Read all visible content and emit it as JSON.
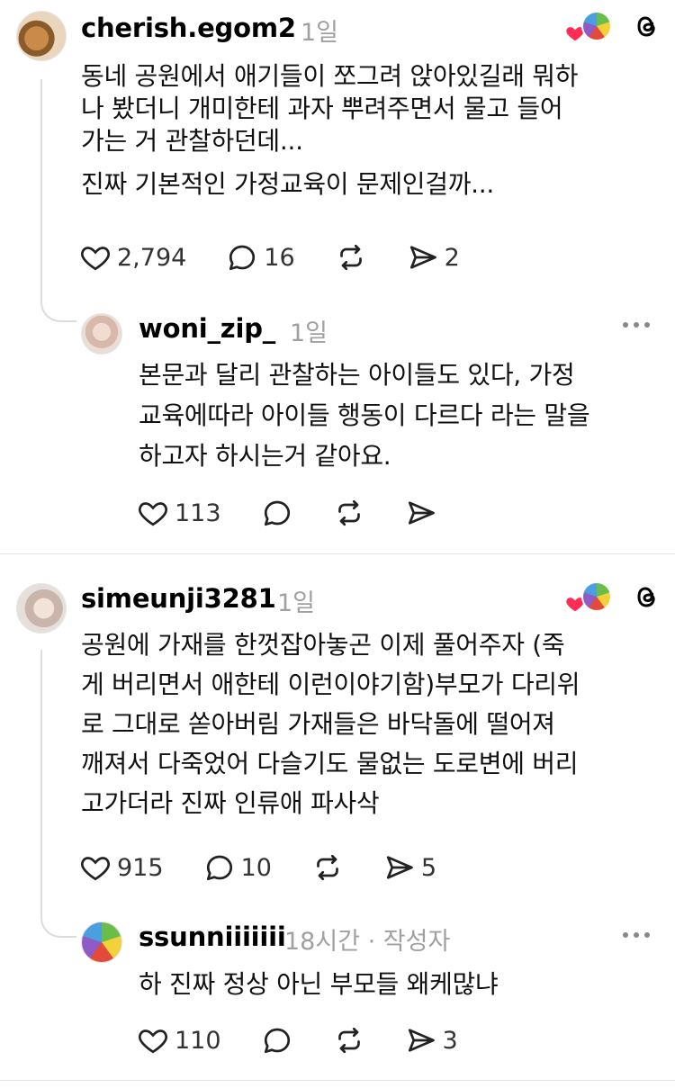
{
  "threads": [
    {
      "username": "cherish.egom2",
      "time": "1일",
      "lines": [
        "동네 공원에서 애기들이 쪼그려 앉아있길래 뭐하",
        "나 봤더니 개미한테 과자 뿌려주면서 물고 들어",
        "가는 거 관찰하던데...",
        "진짜 기본적인 가정교육이 문제인걸까..."
      ],
      "likes": "2,794",
      "replies": "16",
      "shares": "2",
      "reply": {
        "username": "woni_zip_",
        "time": "1일",
        "lines": [
          "본문과 달리 관찰하는 아이들도 있다, 가정",
          "교육에따라 아이들 행동이 다르다 라는 말을",
          "하고자 하시는거 같아요."
        ],
        "likes": "113",
        "replies": "",
        "shares": ""
      }
    },
    {
      "username": "simeunji3281",
      "time": "1일",
      "lines": [
        "공원에 가재를 한껏잡아놓곤 이제 풀어주자 (죽",
        "게 버리면서 애한테 이런이야기함)부모가 다리위",
        "로 그대로 쏟아버림 가재들은 바닥돌에 떨어져",
        "깨져서 다죽었어 다슬기도 물없는 도로변에 버리",
        "고가더라 진짜 인류애 파사삭"
      ],
      "likes": "915",
      "replies": "10",
      "shares": "5",
      "reply": {
        "username": "ssunniiiiiii",
        "time": "18시간 · 작성자",
        "lines": [
          "하 진짜 정상 아닌 부모들 왜케많냐"
        ],
        "likes": "110",
        "replies": "",
        "shares": "3"
      }
    }
  ],
  "icons": {
    "like": "heart-outline-icon",
    "reply": "speech-bubble-icon",
    "repost": "repost-icon",
    "share": "send-icon",
    "more": "more-dots-icon",
    "threads": "threads-logo-icon"
  },
  "colors": {
    "like_badge": "#ff2d55",
    "muted": "#a0a0a0"
  }
}
